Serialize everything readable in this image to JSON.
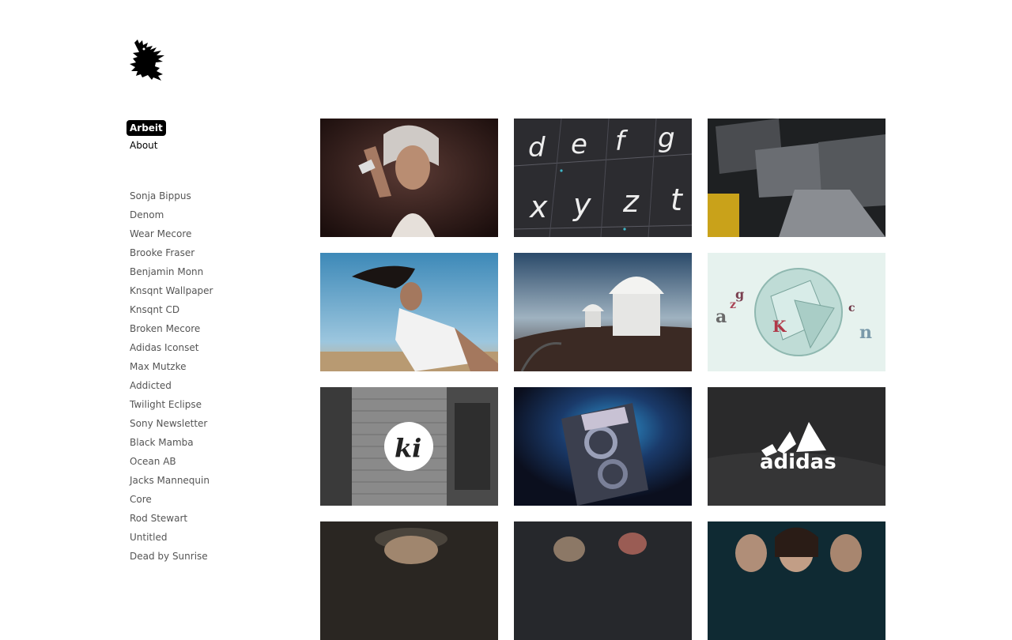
{
  "logo": {
    "icon": "heraldic-lion-icon"
  },
  "nav": {
    "items": [
      {
        "label": "Arbeit",
        "active": true
      },
      {
        "label": "About",
        "active": false
      }
    ]
  },
  "projects": [
    "Sonja Bippus",
    "Denom",
    "Wear Mecore",
    "Brooke Fraser",
    "Benjamin Monn",
    "Knsqnt Wallpaper",
    "Knsqnt CD",
    "Broken Mecore",
    "Adidas Iconset",
    "Max Mutzke",
    "Addicted",
    "Twilight Eclipse",
    "Sony Newsletter",
    "Black Mamba",
    "Ocean AB",
    "Jacks Mannequin",
    "Core",
    "Rod Stewart",
    "Untitled",
    "Dead by Sunrise"
  ],
  "grid": {
    "tiles": [
      {
        "thumb": "portrait-woman-jewelry"
      },
      {
        "thumb": "typeface-keyboard-letters",
        "letters_top": [
          "d",
          "e",
          "f",
          "g"
        ],
        "letters_bottom": [
          "x",
          "y",
          "z",
          "t"
        ]
      },
      {
        "thumb": "3d-type-dark"
      },
      {
        "thumb": "woman-hair-wind-desert"
      },
      {
        "thumb": "observatory-mountain"
      },
      {
        "thumb": "shattered-disc-letters",
        "letters": [
          "g",
          "a",
          "z",
          "K",
          "c",
          "n"
        ]
      },
      {
        "thumb": "brick-wall-ki-logo",
        "text": "ki"
      },
      {
        "thumb": "blue-3d-typography"
      },
      {
        "thumb": "adidas-logo-dark",
        "text": "adidas"
      },
      {
        "thumb": "portrait-man-cap"
      },
      {
        "thumb": "band-photo"
      },
      {
        "thumb": "movie-poster-faces"
      }
    ]
  }
}
